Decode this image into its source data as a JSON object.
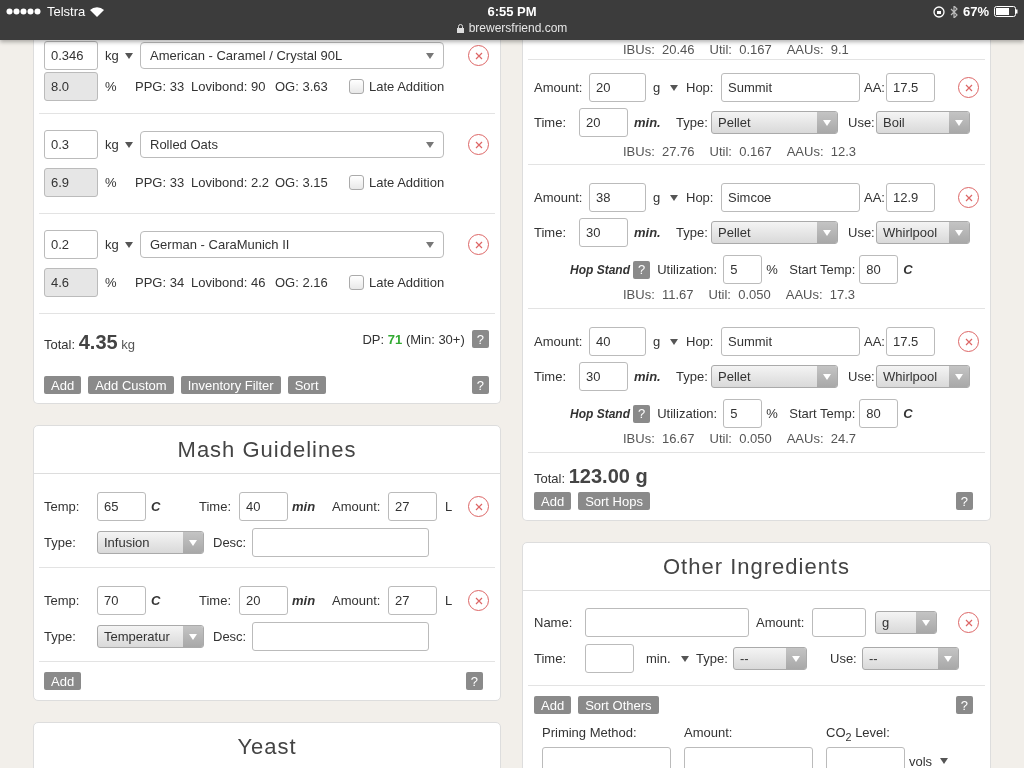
{
  "status_bar": {
    "carrier": "Telstra",
    "time": "6:55 PM",
    "url": "brewersfriend.com",
    "battery": "67%"
  },
  "fermentables": {
    "rows": [
      {
        "amount": "0.346",
        "unit": "kg",
        "grain": "American - Caramel / Crystal 90L",
        "percent": "8.0",
        "percent_unit": "%",
        "ppg": "PPG: 33",
        "lovibond": "Lovibond: 90",
        "og": "OG: 3.63",
        "late_label": "Late Addition",
        "late_addition": false
      },
      {
        "amount": "0.3",
        "unit": "kg",
        "grain": "Rolled Oats",
        "percent": "6.9",
        "percent_unit": "%",
        "ppg": "PPG: 33",
        "lovibond": "Lovibond: 2.2",
        "og": "OG: 3.15",
        "late_label": "Late Addition",
        "late_addition": false
      },
      {
        "amount": "0.2",
        "unit": "kg",
        "grain": "German - CaraMunich II",
        "percent": "4.6",
        "percent_unit": "%",
        "ppg": "PPG: 34",
        "lovibond": "Lovibond: 46",
        "og": "OG: 2.16",
        "late_label": "Late Addition",
        "late_addition": false
      }
    ],
    "total_label": "Total:",
    "total_value": "4.35",
    "total_unit": "kg",
    "dp_label": "DP:",
    "dp_value": "71",
    "dp_min": "(Min: 30+)",
    "dp_help": "?",
    "buttons": [
      "Add",
      "Add Custom",
      "Inventory Filter",
      "Sort"
    ],
    "help": "?"
  },
  "mash": {
    "title": "Mash Guidelines",
    "steps": [
      {
        "temp_label": "Temp:",
        "temp": "65",
        "temp_unit": "C",
        "time_label": "Time:",
        "time": "40",
        "time_unit": "min",
        "amount_label": "Amount:",
        "amount": "27",
        "amount_unit": "L",
        "type_label": "Type:",
        "type": "Infusion",
        "desc_label": "Desc:"
      },
      {
        "temp_label": "Temp:",
        "temp": "70",
        "temp_unit": "C",
        "time_label": "Time:",
        "time": "20",
        "time_unit": "min",
        "amount_label": "Amount:",
        "amount": "27",
        "amount_unit": "L",
        "type_label": "Type:",
        "type": "Temperatur",
        "desc_label": "Desc:"
      }
    ],
    "buttons": [
      "Add"
    ],
    "help": "?"
  },
  "yeast": {
    "title": "Yeast"
  },
  "hops": {
    "partial_stats": [
      "IBUs:  20.46",
      "Util:  0.167",
      "AAUs:  9.1"
    ],
    "rows": [
      {
        "amount_label": "Amount:",
        "amount": "20",
        "unit": "g",
        "hop_label": "Hop:",
        "hop": "Summit",
        "aa_label": "AA:",
        "aa": "17.5",
        "time_label": "Time:",
        "time": "20",
        "time_unit": "min.",
        "type_label": "Type:",
        "type": "Pellet",
        "use_label": "Use:",
        "use": "Boil",
        "stats": [
          "IBUs:  27.76",
          "Util:  0.167",
          "AAUs:  12.3"
        ]
      },
      {
        "amount_label": "Amount:",
        "amount": "38",
        "unit": "g",
        "hop_label": "Hop:",
        "hop": "Simcoe",
        "aa_label": "AA:",
        "aa": "12.9",
        "time_label": "Time:",
        "time": "30",
        "time_unit": "min.",
        "type_label": "Type:",
        "type": "Pellet",
        "use_label": "Use:",
        "use": "Whirlpool",
        "hop_stand": {
          "label": "Hop Stand",
          "help": "?",
          "utilization_label": "Utilization:",
          "utilization": "5",
          "utilization_unit": "%",
          "start_temp_label": "Start Temp:",
          "start_temp": "80",
          "temp_unit": "C"
        },
        "stats": [
          "IBUs:  11.67",
          "Util:  0.050",
          "AAUs:  17.3"
        ]
      },
      {
        "amount_label": "Amount:",
        "amount": "40",
        "unit": "g",
        "hop_label": "Hop:",
        "hop": "Summit",
        "aa_label": "AA:",
        "aa": "17.5",
        "time_label": "Time:",
        "time": "30",
        "time_unit": "min.",
        "type_label": "Type:",
        "type": "Pellet",
        "use_label": "Use:",
        "use": "Whirlpool",
        "hop_stand": {
          "label": "Hop Stand",
          "help": "?",
          "utilization_label": "Utilization:",
          "utilization": "5",
          "utilization_unit": "%",
          "start_temp_label": "Start Temp:",
          "start_temp": "80",
          "temp_unit": "C"
        },
        "stats": [
          "IBUs:  16.67",
          "Util:  0.050",
          "AAUs:  24.7"
        ]
      }
    ],
    "total_label": "Total:",
    "total_value": "123.00 g",
    "buttons": [
      "Add",
      "Sort Hops"
    ],
    "help": "?"
  },
  "other": {
    "title": "Other Ingredients",
    "name_label": "Name:",
    "amount_label": "Amount:",
    "unit": "g",
    "time_label": "Time:",
    "time_unit": "min.",
    "type_label": "Type:",
    "type": "--",
    "use_label": "Use:",
    "use": "--",
    "buttons": [
      "Add",
      "Sort Others"
    ],
    "help": "?",
    "priming_method_label": "Priming Method:",
    "priming_amount_label": "Amount:",
    "co2_label": "CO$_{2}$ Level:",
    "co2_unit": "vols"
  }
}
